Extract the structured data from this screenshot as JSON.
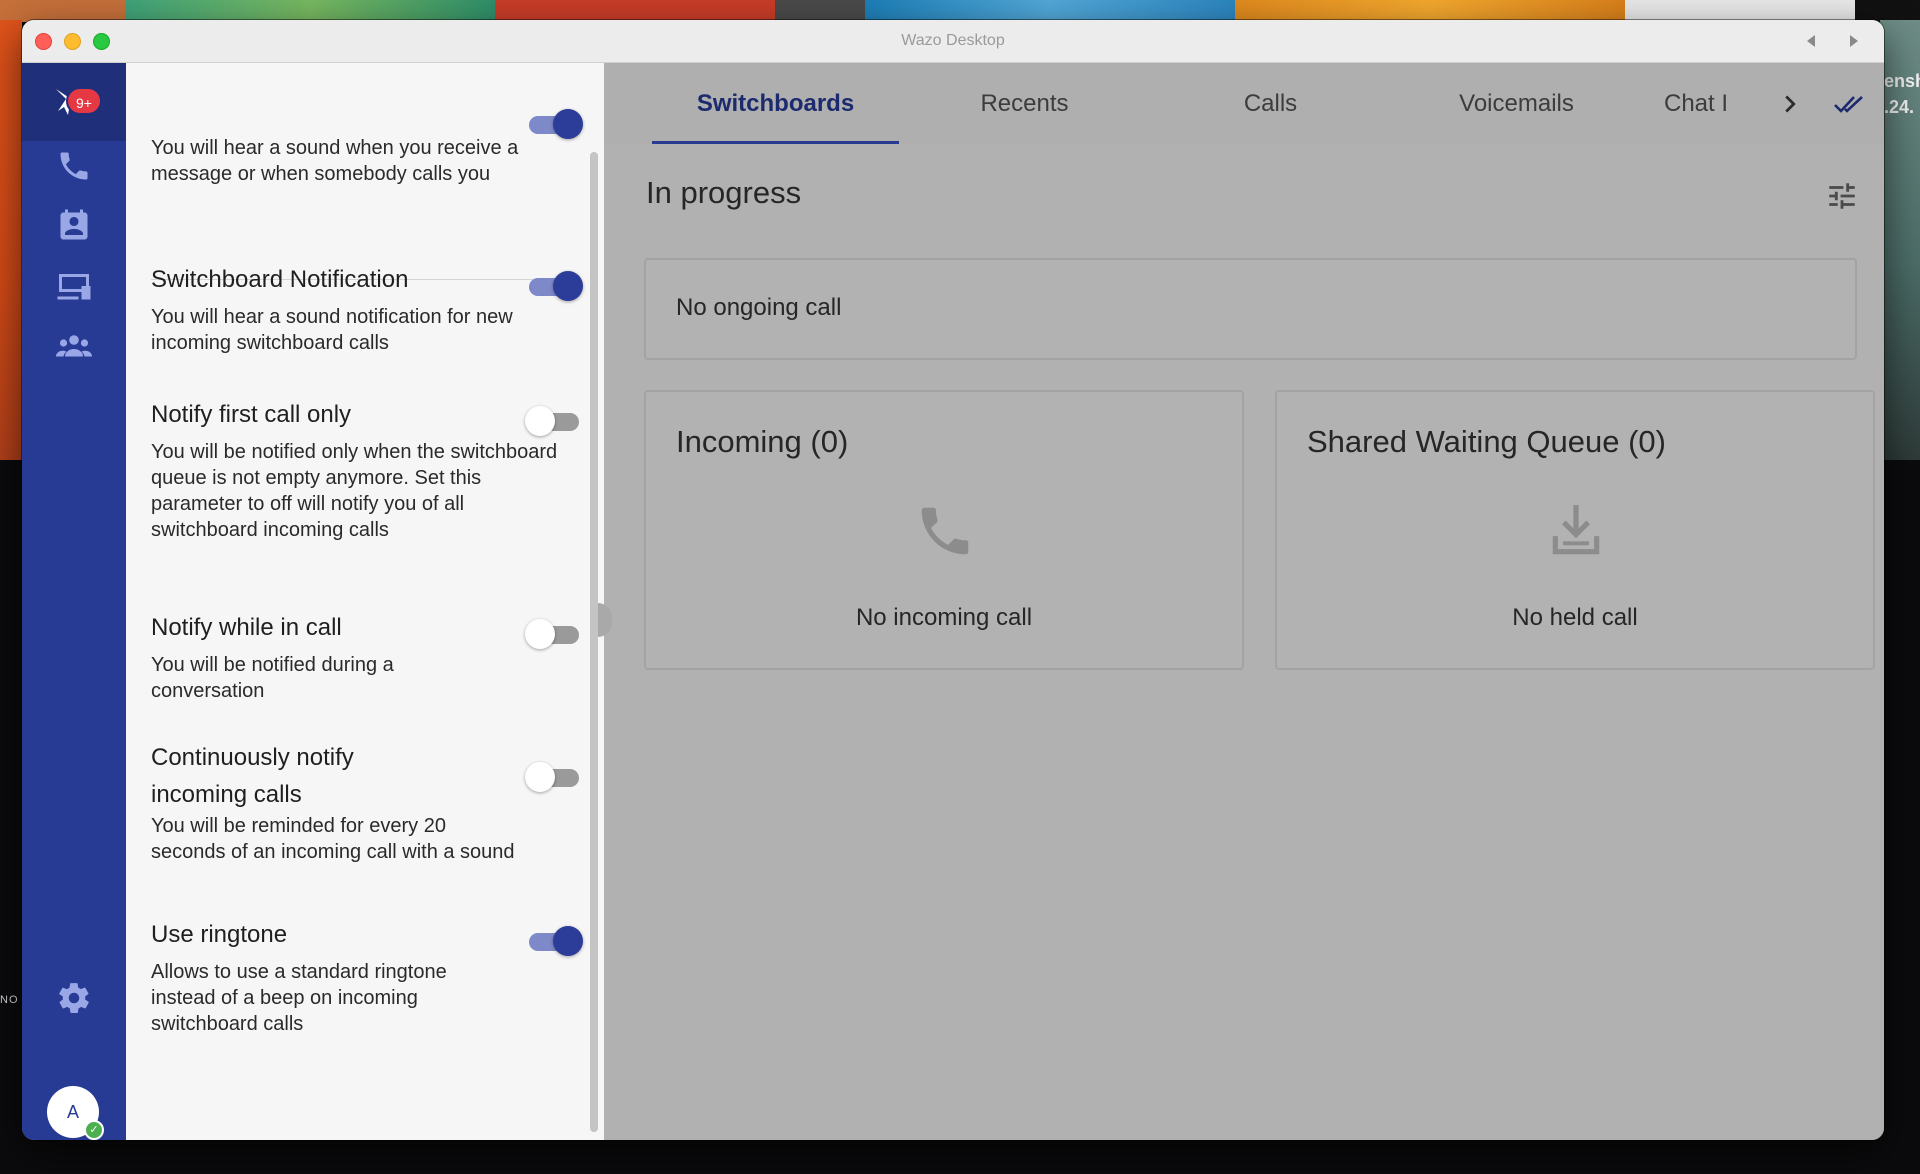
{
  "window": {
    "title": "Wazo Desktop"
  },
  "desktop": {
    "right_art_text": [
      "ensh",
      ".24."
    ],
    "left_mark": "NO"
  },
  "rail": {
    "notification_badge": "9+",
    "avatar_initial": "A",
    "items": [
      {
        "name": "phone",
        "icon": "phone-icon"
      },
      {
        "name": "contacts",
        "icon": "contacts-icon"
      },
      {
        "name": "switchboard",
        "icon": "desktop-phone-icon"
      },
      {
        "name": "groups",
        "icon": "group-icon"
      },
      {
        "name": "settings",
        "icon": "gear-icon"
      }
    ],
    "colors": {
      "rail": "#273b95",
      "logo_bg": "#1f2f7a",
      "badge": "#e53843",
      "status": "#4caf50"
    }
  },
  "settings_panel": {
    "items": [
      {
        "title": "",
        "description": "You will hear a sound when you receive a message or when somebody calls you",
        "enabled": true
      },
      {
        "title": "Switchboard Notification",
        "description": "You will hear a sound notification for new incoming switchboard calls",
        "enabled": true
      },
      {
        "title": "Notify first call only",
        "description": "You will be notified only when the switchboard queue is not empty anymore. Set this parameter to off will notify you of all switchboard incoming calls",
        "enabled": false
      },
      {
        "title": "Notify while in call",
        "description": "You will be notified during a conversation",
        "enabled": false
      },
      {
        "title": "Continuously notify incoming calls",
        "description": "You will be reminded for every 20 seconds of an incoming call with a sound",
        "enabled": false
      },
      {
        "title": "Use ringtone",
        "description": "Allows to use a standard ringtone instead of a beep on incoming switchboard calls",
        "enabled": true
      }
    ],
    "colors": {
      "toggle_on_knob": "#2b3d98",
      "toggle_on_track": "#7d89c8",
      "toggle_off_track": "#9a9a9a"
    }
  },
  "main": {
    "tabs": [
      {
        "label": "Switchboards",
        "active": true
      },
      {
        "label": "Recents",
        "active": false
      },
      {
        "label": "Calls",
        "active": false
      },
      {
        "label": "Voicemails",
        "active": false
      },
      {
        "label": "Chat I",
        "active": false
      }
    ],
    "section_title": "In progress",
    "ongoing": {
      "empty_text": "No ongoing call"
    },
    "incoming": {
      "title": "Incoming (0)",
      "icon": "phone-icon",
      "empty_text": "No incoming call"
    },
    "shared_queue": {
      "title": "Shared Waiting Queue (0)",
      "icon": "download-tray-icon",
      "empty_text": "No held call"
    },
    "colors": {
      "accent": "#2a3b8f",
      "overlay_bg": "#b1b1b1",
      "icon_muted": "#8c8c8c"
    }
  }
}
